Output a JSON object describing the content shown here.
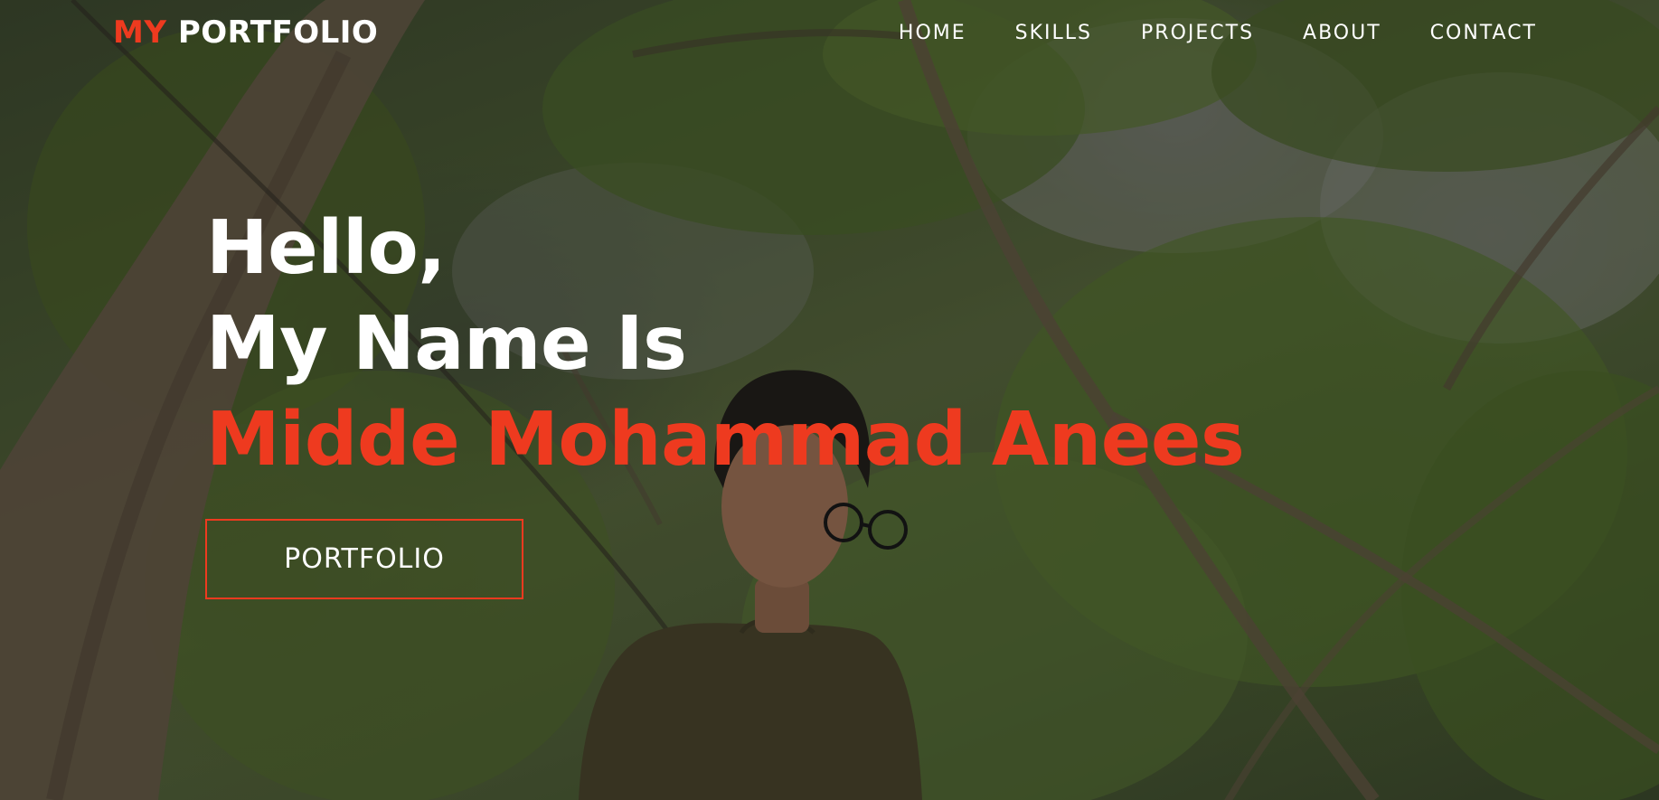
{
  "site": {
    "logo_accent": "MY",
    "logo_text": "PORTFOLIO"
  },
  "nav": {
    "items": [
      {
        "label": "HOME"
      },
      {
        "label": "SKILLS"
      },
      {
        "label": "PROJECTS"
      },
      {
        "label": "ABOUT"
      },
      {
        "label": "CONTACT"
      }
    ]
  },
  "hero": {
    "greeting": "Hello,",
    "intro": "My Name Is",
    "name": "Midde Mohammad Anees",
    "cta_label": "PORTFOLIO",
    "background_image": "person-in-forest-photo"
  },
  "colors": {
    "accent": "#ee3a1f",
    "text": "#ffffff"
  }
}
